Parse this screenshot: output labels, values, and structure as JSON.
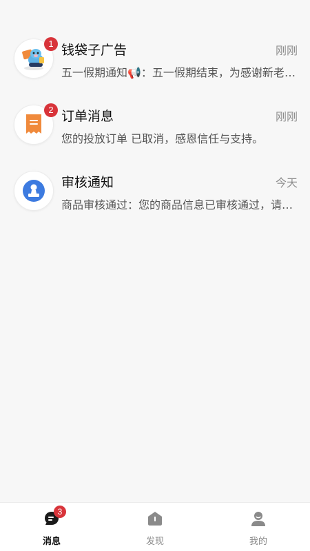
{
  "messages": [
    {
      "title": "钱袋子广告",
      "time": "刚刚",
      "preview": "五一假期通知📢：五一假期结束，为感谢新老用户的支持",
      "badge": "1",
      "icon": "piggy-mascot-icon"
    },
    {
      "title": "订单消息",
      "time": "刚刚",
      "preview": "您的投放订单 已取消，感恩信任与支持。",
      "badge": "2",
      "icon": "receipt-icon"
    },
    {
      "title": "审核通知",
      "time": "今天",
      "preview": "商品审核通过：您的商品信息已审核通过，请及时查看",
      "badge": "",
      "icon": "stamp-icon"
    }
  ],
  "tabbar": {
    "tabs": [
      {
        "label": "消息",
        "icon": "chat-bubble-icon",
        "badge": "3",
        "active": true
      },
      {
        "label": "发现",
        "icon": "discover-house-icon",
        "badge": "",
        "active": false
      },
      {
        "label": "我的",
        "icon": "profile-person-icon",
        "badge": "",
        "active": false
      }
    ]
  },
  "colors": {
    "badge": "#d8343a",
    "background": "#f7f7f7",
    "receipt_orange": "#f08a3c",
    "stamp_blue": "#3d7be0"
  }
}
